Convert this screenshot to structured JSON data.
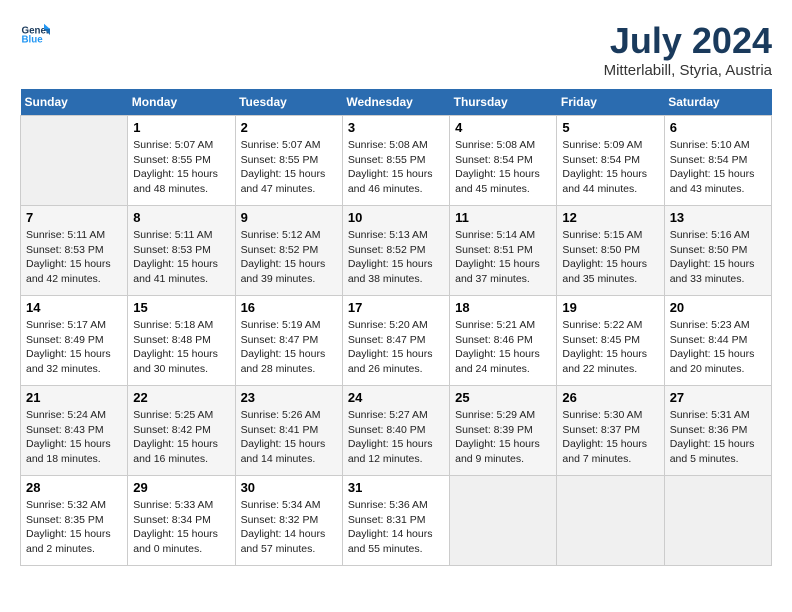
{
  "header": {
    "logo": "GeneralBlue",
    "month": "July 2024",
    "location": "Mitterlabill, Styria, Austria"
  },
  "days_of_week": [
    "Sunday",
    "Monday",
    "Tuesday",
    "Wednesday",
    "Thursday",
    "Friday",
    "Saturday"
  ],
  "weeks": [
    [
      {
        "day": "",
        "info": ""
      },
      {
        "day": "1",
        "info": "Sunrise: 5:07 AM\nSunset: 8:55 PM\nDaylight: 15 hours\nand 48 minutes."
      },
      {
        "day": "2",
        "info": "Sunrise: 5:07 AM\nSunset: 8:55 PM\nDaylight: 15 hours\nand 47 minutes."
      },
      {
        "day": "3",
        "info": "Sunrise: 5:08 AM\nSunset: 8:55 PM\nDaylight: 15 hours\nand 46 minutes."
      },
      {
        "day": "4",
        "info": "Sunrise: 5:08 AM\nSunset: 8:54 PM\nDaylight: 15 hours\nand 45 minutes."
      },
      {
        "day": "5",
        "info": "Sunrise: 5:09 AM\nSunset: 8:54 PM\nDaylight: 15 hours\nand 44 minutes."
      },
      {
        "day": "6",
        "info": "Sunrise: 5:10 AM\nSunset: 8:54 PM\nDaylight: 15 hours\nand 43 minutes."
      }
    ],
    [
      {
        "day": "7",
        "info": "Sunrise: 5:11 AM\nSunset: 8:53 PM\nDaylight: 15 hours\nand 42 minutes."
      },
      {
        "day": "8",
        "info": "Sunrise: 5:11 AM\nSunset: 8:53 PM\nDaylight: 15 hours\nand 41 minutes."
      },
      {
        "day": "9",
        "info": "Sunrise: 5:12 AM\nSunset: 8:52 PM\nDaylight: 15 hours\nand 39 minutes."
      },
      {
        "day": "10",
        "info": "Sunrise: 5:13 AM\nSunset: 8:52 PM\nDaylight: 15 hours\nand 38 minutes."
      },
      {
        "day": "11",
        "info": "Sunrise: 5:14 AM\nSunset: 8:51 PM\nDaylight: 15 hours\nand 37 minutes."
      },
      {
        "day": "12",
        "info": "Sunrise: 5:15 AM\nSunset: 8:50 PM\nDaylight: 15 hours\nand 35 minutes."
      },
      {
        "day": "13",
        "info": "Sunrise: 5:16 AM\nSunset: 8:50 PM\nDaylight: 15 hours\nand 33 minutes."
      }
    ],
    [
      {
        "day": "14",
        "info": "Sunrise: 5:17 AM\nSunset: 8:49 PM\nDaylight: 15 hours\nand 32 minutes."
      },
      {
        "day": "15",
        "info": "Sunrise: 5:18 AM\nSunset: 8:48 PM\nDaylight: 15 hours\nand 30 minutes."
      },
      {
        "day": "16",
        "info": "Sunrise: 5:19 AM\nSunset: 8:47 PM\nDaylight: 15 hours\nand 28 minutes."
      },
      {
        "day": "17",
        "info": "Sunrise: 5:20 AM\nSunset: 8:47 PM\nDaylight: 15 hours\nand 26 minutes."
      },
      {
        "day": "18",
        "info": "Sunrise: 5:21 AM\nSunset: 8:46 PM\nDaylight: 15 hours\nand 24 minutes."
      },
      {
        "day": "19",
        "info": "Sunrise: 5:22 AM\nSunset: 8:45 PM\nDaylight: 15 hours\nand 22 minutes."
      },
      {
        "day": "20",
        "info": "Sunrise: 5:23 AM\nSunset: 8:44 PM\nDaylight: 15 hours\nand 20 minutes."
      }
    ],
    [
      {
        "day": "21",
        "info": "Sunrise: 5:24 AM\nSunset: 8:43 PM\nDaylight: 15 hours\nand 18 minutes."
      },
      {
        "day": "22",
        "info": "Sunrise: 5:25 AM\nSunset: 8:42 PM\nDaylight: 15 hours\nand 16 minutes."
      },
      {
        "day": "23",
        "info": "Sunrise: 5:26 AM\nSunset: 8:41 PM\nDaylight: 15 hours\nand 14 minutes."
      },
      {
        "day": "24",
        "info": "Sunrise: 5:27 AM\nSunset: 8:40 PM\nDaylight: 15 hours\nand 12 minutes."
      },
      {
        "day": "25",
        "info": "Sunrise: 5:29 AM\nSunset: 8:39 PM\nDaylight: 15 hours\nand 9 minutes."
      },
      {
        "day": "26",
        "info": "Sunrise: 5:30 AM\nSunset: 8:37 PM\nDaylight: 15 hours\nand 7 minutes."
      },
      {
        "day": "27",
        "info": "Sunrise: 5:31 AM\nSunset: 8:36 PM\nDaylight: 15 hours\nand 5 minutes."
      }
    ],
    [
      {
        "day": "28",
        "info": "Sunrise: 5:32 AM\nSunset: 8:35 PM\nDaylight: 15 hours\nand 2 minutes."
      },
      {
        "day": "29",
        "info": "Sunrise: 5:33 AM\nSunset: 8:34 PM\nDaylight: 15 hours\nand 0 minutes."
      },
      {
        "day": "30",
        "info": "Sunrise: 5:34 AM\nSunset: 8:32 PM\nDaylight: 14 hours\nand 57 minutes."
      },
      {
        "day": "31",
        "info": "Sunrise: 5:36 AM\nSunset: 8:31 PM\nDaylight: 14 hours\nand 55 minutes."
      },
      {
        "day": "",
        "info": ""
      },
      {
        "day": "",
        "info": ""
      },
      {
        "day": "",
        "info": ""
      }
    ]
  ]
}
